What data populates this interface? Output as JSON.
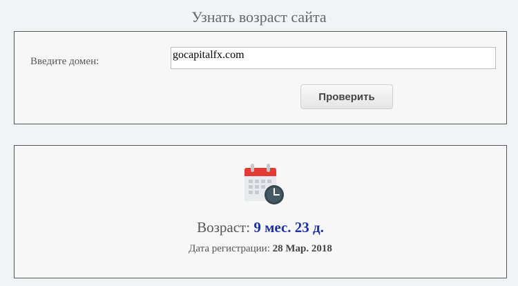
{
  "page": {
    "title": "Узнать возраст сайта"
  },
  "form": {
    "domain_label": "Введите домен:",
    "domain_value": "gocapitalfx.com",
    "check_button_label": "Проверить"
  },
  "result": {
    "icon": "calendar-clock-icon",
    "age_label": "Возраст:",
    "age_value": "9 мес. 23 д.",
    "registration_label": "Дата регистрации:",
    "registration_value": "28 Мар. 2018"
  },
  "colors": {
    "age_value": "#1a2fa8",
    "calendar_header": "#e53935",
    "clock_face": "#37474f"
  }
}
